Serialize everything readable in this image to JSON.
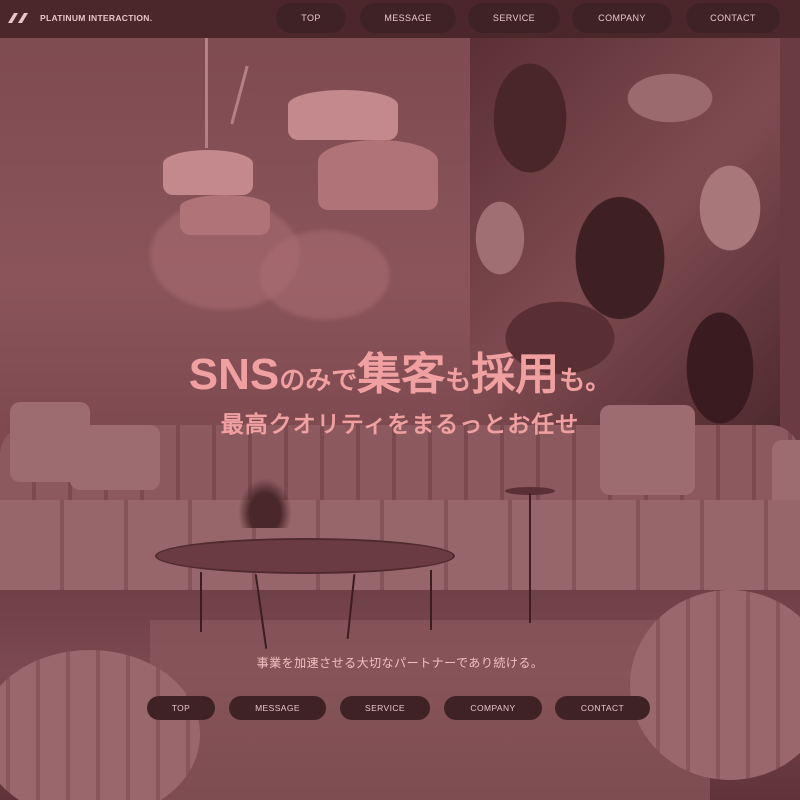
{
  "brand": {
    "name": "PLATINUM INTERACTION.",
    "logo_icon": "slash-pair-icon"
  },
  "header_nav": [
    {
      "label": "TOP"
    },
    {
      "label": "MESSAGE"
    },
    {
      "label": "SERVICE"
    },
    {
      "label": "COMPANY"
    },
    {
      "label": "CONTACT"
    }
  ],
  "hero": {
    "headline_parts": [
      "SNS",
      "のみで",
      "集客",
      "も",
      "採用",
      "も。"
    ],
    "subheadline": "最高クオリティをまるっとお任せ",
    "tagline": "事業を加速させる大切なパートナーであり続ける。"
  },
  "footer_nav": [
    {
      "label": "TOP"
    },
    {
      "label": "MESSAGE"
    },
    {
      "label": "SERVICE"
    },
    {
      "label": "COMPANY"
    },
    {
      "label": "CONTACT"
    }
  ],
  "colors": {
    "overlay": "#7d4a50",
    "headline": "#f0a0a0",
    "nav_bg": "#3f2226",
    "nav_text": "#e8c6c8"
  }
}
